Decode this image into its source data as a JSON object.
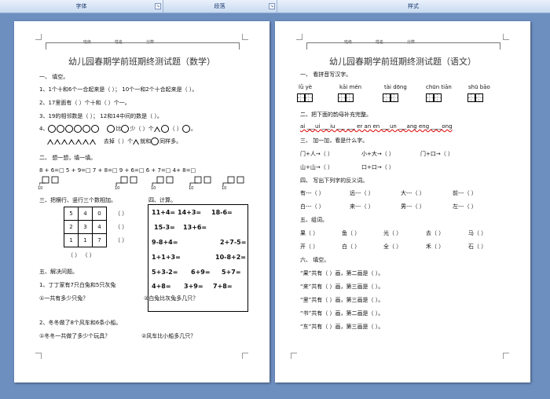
{
  "ribbon": {
    "groups": [
      {
        "label": "字体"
      },
      {
        "label": "段落"
      },
      {
        "label": "样式"
      }
    ]
  },
  "left": {
    "header_fields": [
      "班级",
      "姓名",
      "分数"
    ],
    "title": "幼儿园春期学前班期终测试题（数学）",
    "s1_head": "一、  填空。",
    "q1": "1、1个十和6个一合起来是（        ）；  10个一和2个十合起来是（        ）。",
    "q2": "2、17里面有（      ）个十和（      ）个一。",
    "q3": "3、19的相邻数是（        ）；   12和14中间的数是（        ）。",
    "q4_a": "4、",
    "q4_b": "比",
    "q4_c": "少（        ）个",
    "q4_d": "（        ）",
    "q4_e": "。",
    "q4_f": "去掉（        ）个",
    "q4_g": "就和",
    "q4_h": "同样多。",
    "s2_head": "二、  想一想，填一填。",
    "s2_row": "8 + 6=□    5 + 9=□    7 + 8=□    9 + 6=□    6 + 7=□    4+  8=□",
    "s2_nums": [
      "10",
      "10",
      "10",
      "10",
      "10",
      "10"
    ],
    "s3_head": "三、把横行、竖行三个数相加。",
    "grid": [
      [
        "5",
        "4",
        "0"
      ],
      [
        "2",
        "3",
        "4"
      ],
      [
        "1",
        "1",
        "7"
      ]
    ],
    "grid_paren": "（        ）",
    "s4_head": "四、计算。",
    "calcs": [
      [
        "11+4=",
        "14+3=",
        "18-6="
      ],
      [
        "15-3=",
        "13+6=",
        ""
      ],
      [
        "9-8+4=",
        "",
        "2+7-5="
      ],
      [
        "1+1+3=",
        "",
        "10-8+2="
      ],
      [
        "5+3-2=",
        "6+9=",
        "5+7="
      ],
      [
        "4+8=",
        "3+9=",
        "7+8="
      ]
    ],
    "s5_head": "五、解决问题。",
    "p1": "1、丁丁家有7只白兔和5只灰兔",
    "p1_a": "①一共有多少只兔？",
    "p1_b": "②白兔比灰兔多几只？",
    "p2": "2、冬冬做了8个风车和6条小船。",
    "p2_a": "①冬冬一共做了多少个玩具？",
    "p2_b": "②风车比小船多几只？"
  },
  "right": {
    "header_fields": [
      "班级",
      "姓名",
      "分数"
    ],
    "title": "幼儿园春期学前班期终测试题（语文）",
    "s1_head": "一、  看拼音写汉字。",
    "pinyin": [
      "lǜ  yè",
      "kāi  mén",
      "tài  dōng",
      "chūn tiān",
      "shū  bāo"
    ],
    "s2_head": "二、把下面的韵母补充完整。",
    "s2_row": "ai  ___ui  ___iu  ___  ___ er  an  en  ___un  ___ang  eng  ____ong",
    "s3_head": "三、  加一加，看是什么字。",
    "s3_rows": [
      [
        "门+人→（        ）",
        "小+大→（        ）",
        "门+口→（        ）"
      ],
      [
        "山+山→（        ）",
        "口+口→（        ）",
        ""
      ]
    ],
    "s4_head": "四、  写出下列字的反义词。",
    "s4_rows": [
      [
        "有---（        ）",
        "远---（        ）",
        "大---（        ）",
        "前---（        ）"
      ],
      [
        "白---（        ）",
        "来---（        ）",
        "男---（        ）",
        "左---（        ）"
      ]
    ],
    "s5_head": "五、组词。",
    "s5_rows": [
      [
        "果（        ）",
        "鱼（        ）",
        "光（        ）",
        "去（        ）",
        "马（        ）"
      ],
      [
        "开（        ）",
        "白（        ）",
        "全（        ）",
        "禾（        ）",
        "石（        ）"
      ]
    ],
    "s6_head": "六、  填空。",
    "s6_rows": [
      "“果”共有（      ）画，第二画是（      ）。",
      "“来”共有（      ）画，第三画是（      ）。",
      "“里”共有（      ）画，第三画是（      ）。",
      "“书”共有（      ）画，第二画是（      ）。",
      "“东”共有（      ）画，第三画是（      ）。"
    ]
  }
}
